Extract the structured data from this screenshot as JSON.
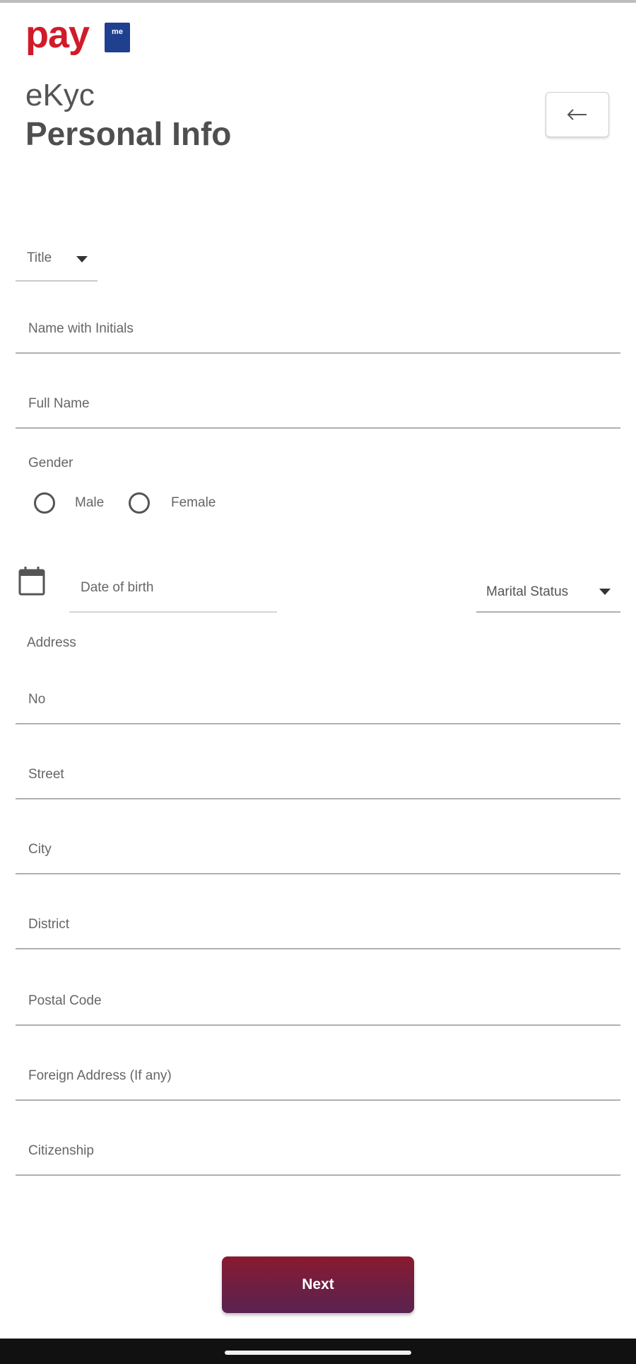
{
  "colors": {
    "brand_red": "#d11a2a",
    "brand_blue": "#1f3f8f",
    "next_button": "#6b1f44",
    "nav_bar": "#111111"
  },
  "logo": {
    "text": "pay",
    "badge": "me"
  },
  "header": {
    "app_name": "eKyc",
    "page_title": "Personal Info",
    "back_icon": "arrow-left-icon"
  },
  "form": {
    "title_select": {
      "placeholder": "Title"
    },
    "name_with_initials": {
      "placeholder": "Name with Initials"
    },
    "full_name": {
      "placeholder": "Full Name"
    },
    "gender": {
      "label": "Gender",
      "options": [
        {
          "label": "Male",
          "selected": false
        },
        {
          "label": "Female",
          "selected": false
        }
      ]
    },
    "date_of_birth": {
      "placeholder": "Date of birth",
      "icon": "calendar-icon"
    },
    "marital_status": {
      "placeholder": "Marital Status"
    },
    "address": {
      "label": "Address",
      "no": {
        "placeholder": "No"
      },
      "street": {
        "placeholder": "Street"
      },
      "city": {
        "placeholder": "City"
      },
      "district": {
        "placeholder": "District"
      },
      "postal_code": {
        "placeholder": "Postal Code"
      }
    },
    "foreign_address": {
      "placeholder": "Foreign Address (If any)"
    },
    "citizenship": {
      "placeholder": "Citizenship"
    }
  },
  "actions": {
    "next_label": "Next"
  }
}
